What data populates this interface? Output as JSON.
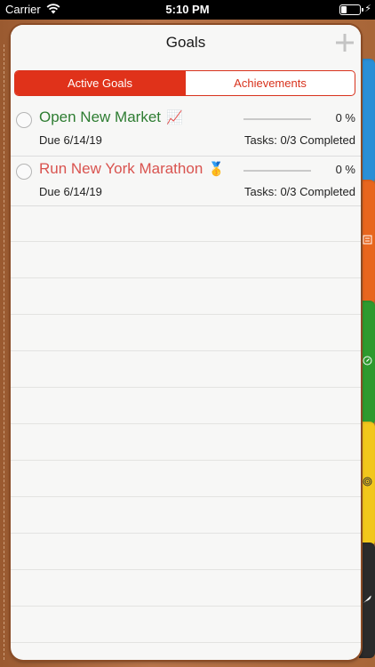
{
  "status_bar": {
    "carrier": "Carrier",
    "time": "5:10 PM",
    "wifi_icon": "wifi-icon",
    "battery_icon": "battery-icon"
  },
  "header": {
    "title": "Goals",
    "add_icon": "plus-icon"
  },
  "segments": {
    "active": "Active Goals",
    "achievements": "Achievements"
  },
  "goals": [
    {
      "title": "Open New Market",
      "emoji": "📈",
      "title_color": "#2e7d32",
      "progress_percent": 0,
      "percent_label": "0 %",
      "due": "Due 6/14/19",
      "tasks": "Tasks: 0/3 Completed"
    },
    {
      "title": "Run New York Marathon",
      "emoji": "🥇",
      "title_color": "#d9534f",
      "progress_percent": 0,
      "percent_label": "0 %",
      "due": "Due 6/14/19",
      "tasks": "Tasks: 0/3 Completed"
    }
  ],
  "side_tabs": [
    {
      "color": "#2a8fd6",
      "icon": "blank"
    },
    {
      "color": "#e8661e",
      "icon": "list-icon"
    },
    {
      "color": "#2e9a2e",
      "icon": "compass-icon"
    },
    {
      "color": "#f2c71c",
      "icon": "target-icon"
    },
    {
      "color": "#2b2b2b",
      "icon": "feather-icon"
    }
  ],
  "colors": {
    "accent": "#e0321a",
    "paper": "#f7f7f6",
    "leather": "#b06a3a"
  }
}
